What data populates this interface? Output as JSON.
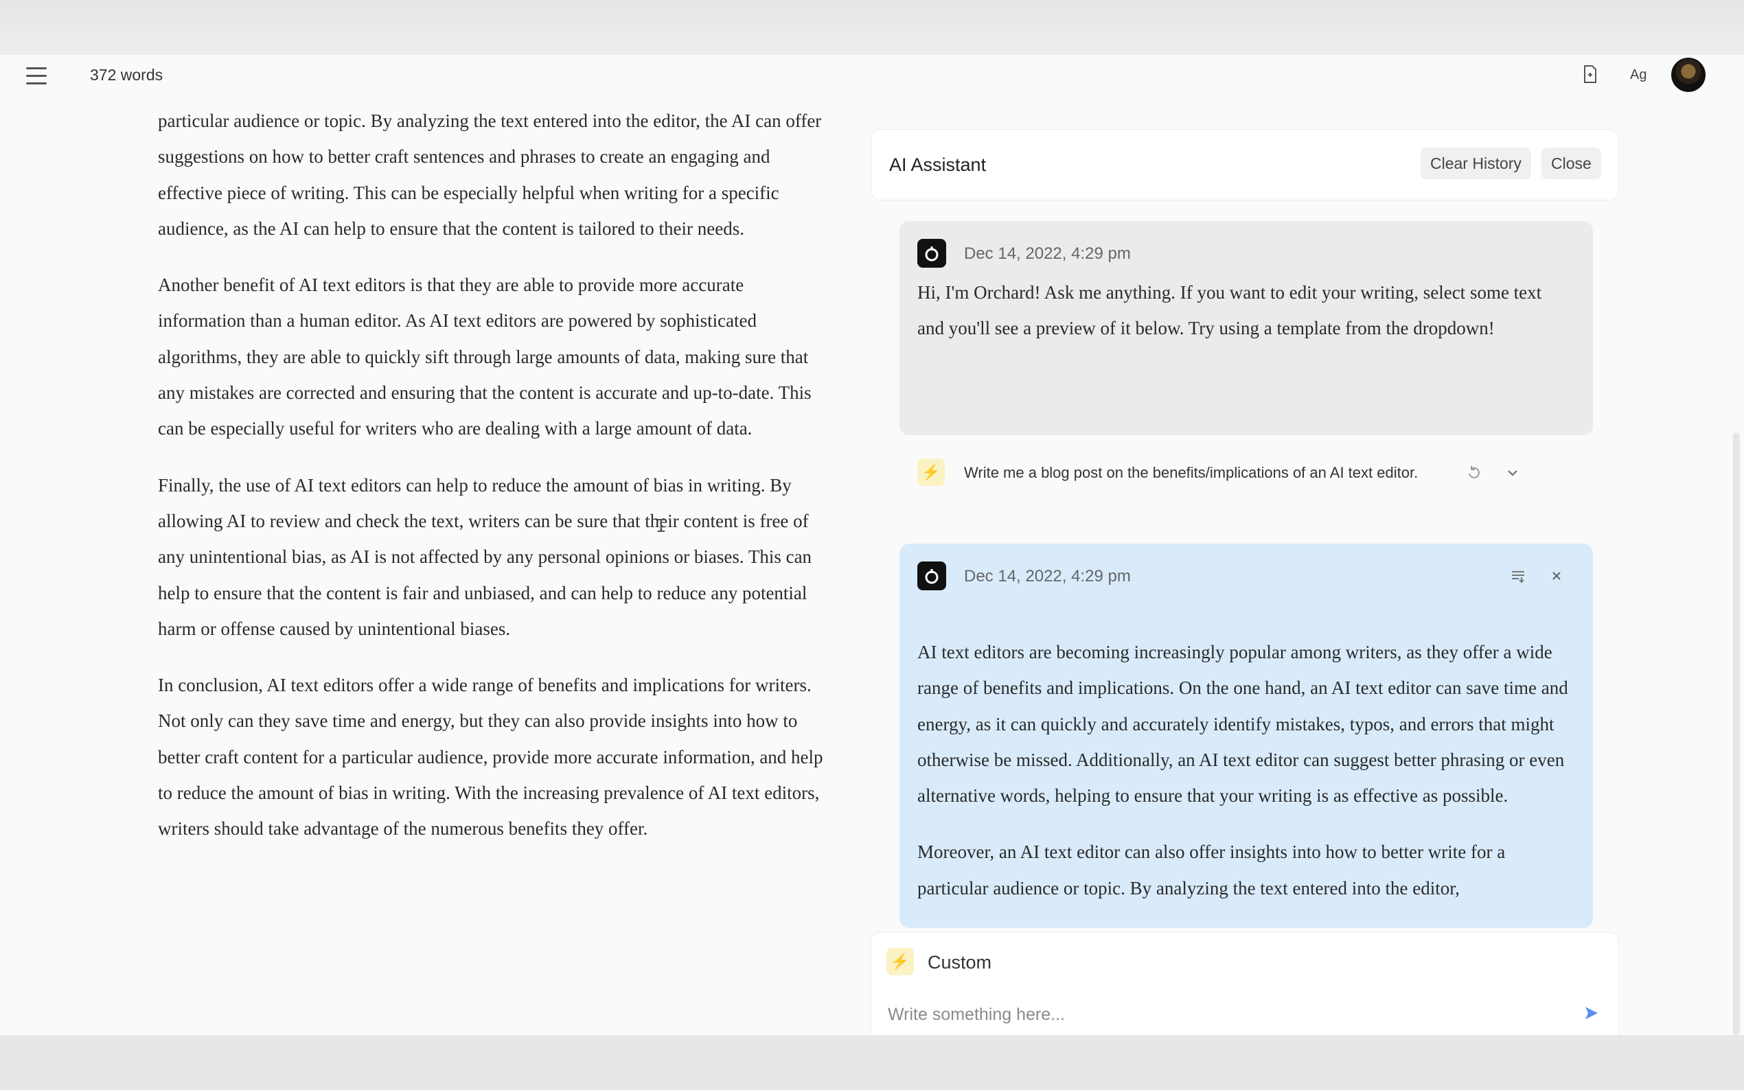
{
  "header": {
    "word_count": "372 words",
    "menu_icon": "hamburger-menu-icon",
    "doc_icon": "document-icon",
    "font_icon_text": "Ag",
    "avatar": "user-avatar"
  },
  "editor": {
    "paragraphs": [
      "particular audience or topic. By analyzing the text entered into the editor, the AI can offer suggestions on how to better craft sentences and phrases to create an engaging and effective piece of writing. This can be especially helpful when writing for a specific audience, as the AI can help to ensure that the content is tailored to their needs.",
      "Another benefit of AI text editors is that they are able to provide more accurate information than a human editor. As AI text editors are powered by sophisticated algorithms, they are able to quickly sift through large amounts of data, making sure that any mistakes are corrected and ensuring that the content is accurate and up-to-date. This can be especially useful for writers who are dealing with a large amount of data.",
      "Finally, the use of AI text editors can help to reduce the amount of bias in writing. By allowing AI to review and check the text, writers can be sure that their content is free of any unintentional bias, as AI is not affected by any personal opinions or biases. This can help to ensure that the content is fair and unbiased, and can help to reduce any potential harm or offense caused by unintentional biases.",
      "In conclusion, AI text editors offer a wide range of benefits and implications for writers. Not only can they save time and energy, but they can also provide insights into how to better craft content for a particular audience, provide more accurate information, and help to reduce the amount of bias in writing. With the increasing prevalence of AI text editors, writers should take advantage of the numerous benefits they offer."
    ]
  },
  "assistant": {
    "title": "AI Assistant",
    "clear_history": "Clear History",
    "close": "Close",
    "messages": [
      {
        "time": "Dec 14, 2022, 4:29 pm",
        "text": "Hi, I'm Orchard! Ask me anything. If you want to edit your writing, select some text and you'll see a preview of it below. Try using a template from the dropdown!"
      },
      {
        "time": "Dec 14, 2022, 4:29 pm",
        "paragraphs": [
          "AI text editors are becoming increasingly popular among writers, as they offer a wide range of benefits and implications. On the one hand, an AI text editor can save time and energy, as it can quickly and accurately identify mistakes, typos, and errors that might otherwise be missed. Additionally, an AI text editor can suggest better phrasing or even alternative words, helping to ensure that your writing is as effective as possible.",
          "Moreover, an AI text editor can also offer insights into how to better write for a particular audience or topic. By analyzing the text entered into the editor,"
        ]
      }
    ],
    "prompt": {
      "text": "Write me a blog post on the benefits/implications of an AI text editor."
    },
    "composer": {
      "template": "Custom",
      "placeholder": "Write something here..."
    }
  },
  "colors": {
    "bot_bubble": "#ebebeb",
    "response_bubble": "#d9ebfb",
    "spark_bg": "#fbf2c4",
    "send": "#3b82f6"
  }
}
